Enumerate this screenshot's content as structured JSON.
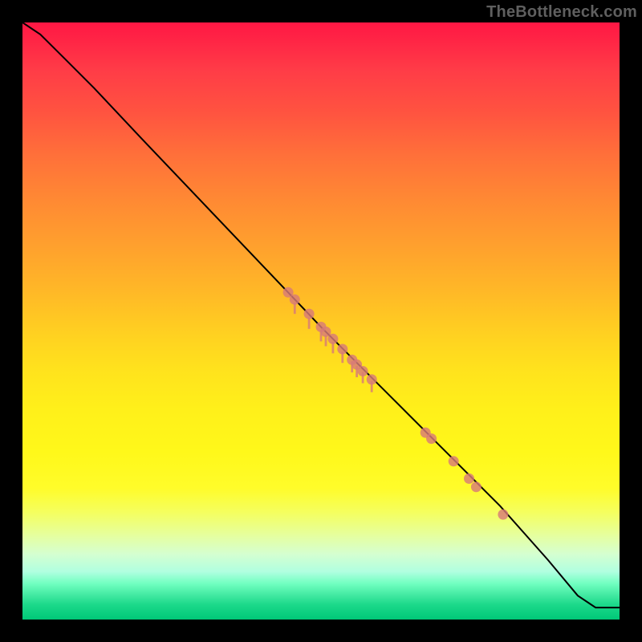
{
  "watermark": "TheBottleneck.com",
  "chart_data": {
    "type": "line",
    "title": "",
    "xlabel": "",
    "ylabel": "",
    "xlim": [
      0,
      100
    ],
    "ylim": [
      0,
      100
    ],
    "series": [
      {
        "name": "curve",
        "x": [
          0,
          3,
          7,
          12,
          20,
          30,
          40,
          50,
          60,
          70,
          80,
          88,
          93,
          96,
          100
        ],
        "y": [
          100,
          98,
          94,
          89,
          80.5,
          70,
          59.5,
          49,
          39,
          29,
          19,
          10,
          4,
          2,
          2
        ]
      }
    ],
    "markers": {
      "name": "highlighted-points",
      "x": [
        44.5,
        45.6,
        48.0,
        50.0,
        50.8,
        52.0,
        53.6,
        55.2,
        56.0,
        57.0,
        58.5,
        67.5,
        68.5,
        72.2,
        74.8,
        76.0,
        80.5
      ],
      "y": [
        54.8,
        53.6,
        51.2,
        49.0,
        48.2,
        47.0,
        45.3,
        43.5,
        42.7,
        41.6,
        40.2,
        31.3,
        30.3,
        26.5,
        23.6,
        22.2,
        17.6
      ]
    },
    "marker_ticks": {
      "x": [
        50.0,
        50.8,
        52.0,
        53.6,
        55.2,
        56.0,
        57.0,
        58.5,
        45.6,
        48.0
      ]
    },
    "background": {
      "gradient": [
        "#ff1744",
        "#ffe21d",
        "#fffc2a",
        "#00c878"
      ],
      "direction": "top-to-bottom"
    }
  }
}
